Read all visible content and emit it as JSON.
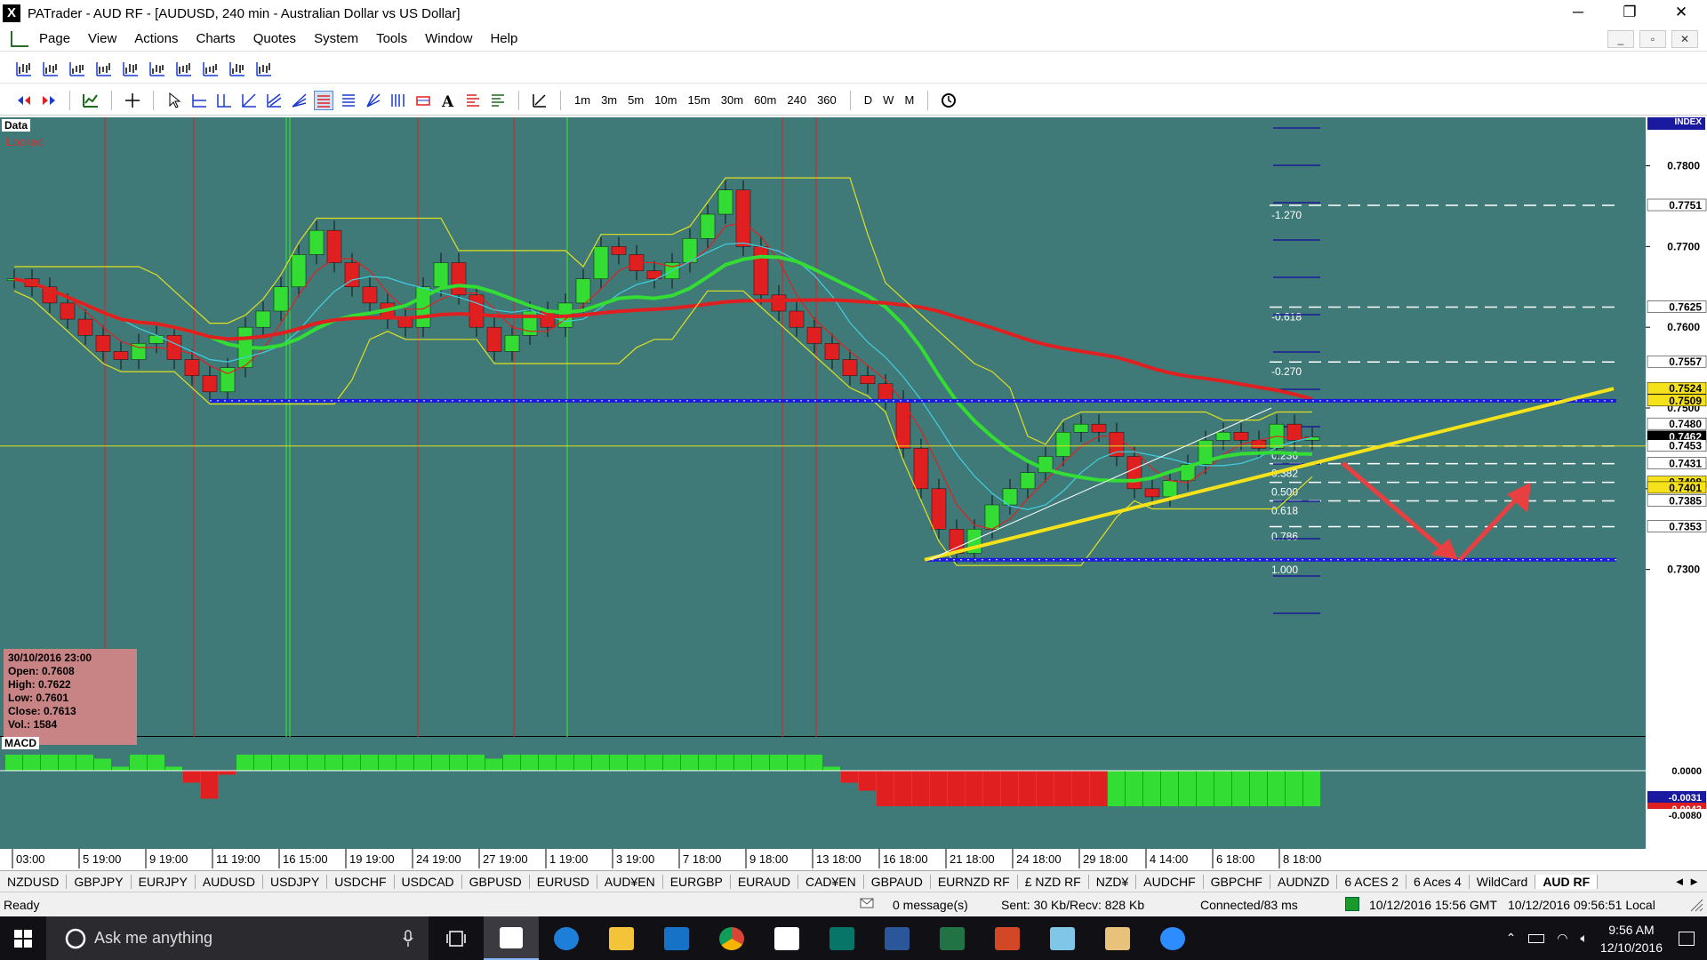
{
  "window": {
    "title": "PATrader - AUD RF - [AUDUSD, 240 min - Australian Dollar vs US Dollar]",
    "logo": "X",
    "minimize": "─",
    "restore": "❐",
    "close": "✕"
  },
  "menu": {
    "items": [
      "Page",
      "View",
      "Actions",
      "Charts",
      "Quotes",
      "System",
      "Tools",
      "Window",
      "Help"
    ],
    "mdi_min": "_",
    "mdi_restore": "▫",
    "mdi_close": "✕"
  },
  "timeframes": [
    "1m",
    "3m",
    "5m",
    "10m",
    "15m",
    "30m",
    "60m",
    "240",
    "360"
  ],
  "periods": [
    "D",
    "W",
    "M"
  ],
  "chart": {
    "data_label": "Data",
    "locked_label": "Locked",
    "index_label": "INDEX",
    "macd_label": "MACD",
    "ohlc": {
      "date": "30/10/2016 23:00",
      "open": "Open: 0.7608",
      "high": "High: 0.7622",
      "low": "Low: 0.7601",
      "close": "Close: 0.7613",
      "vol": "Vol.: 1584"
    },
    "price_ticks": [
      {
        "label": "0.7800",
        "value": 0.78
      },
      {
        "label": "0.7700",
        "value": 0.77
      },
      {
        "label": "0.7600",
        "value": 0.76
      },
      {
        "label": "0.7500",
        "value": 0.75
      },
      {
        "label": "0.7400",
        "value": 0.74
      },
      {
        "label": "0.7300",
        "value": 0.73
      }
    ],
    "price_badges": [
      {
        "label": "0.7751",
        "value": 0.7751,
        "bg": "#ffffff",
        "fg": "#000000"
      },
      {
        "label": "0.7625",
        "value": 0.7625,
        "bg": "#ffffff",
        "fg": "#000000"
      },
      {
        "label": "0.7557",
        "value": 0.7557,
        "bg": "#ffffff",
        "fg": "#000000"
      },
      {
        "label": "0.7524",
        "value": 0.7524,
        "bg": "#f5e21a",
        "fg": "#000000"
      },
      {
        "label": "0.7509",
        "value": 0.7509,
        "bg": "#f5e21a",
        "fg": "#000000"
      },
      {
        "label": "0.7480",
        "value": 0.748,
        "bg": "#ffffff",
        "fg": "#000000"
      },
      {
        "label": "0.7462",
        "value": 0.7464,
        "bg": "#000000",
        "fg": "#ffffff"
      },
      {
        "label": "0.7453",
        "value": 0.7453,
        "bg": "#ffffff",
        "fg": "#000000"
      },
      {
        "label": "0.7431",
        "value": 0.7431,
        "bg": "#ffffff",
        "fg": "#000000"
      },
      {
        "label": "0.7408",
        "value": 0.7408,
        "bg": "#f5e21a",
        "fg": "#000000"
      },
      {
        "label": "0.7401",
        "value": 0.7401,
        "bg": "#f5e21a",
        "fg": "#000000"
      },
      {
        "label": "0.7385",
        "value": 0.7385,
        "bg": "#ffffff",
        "fg": "#000000"
      },
      {
        "label": "0.7353",
        "value": 0.7353,
        "bg": "#ffffff",
        "fg": "#000000"
      }
    ],
    "fib_levels": [
      {
        "label": "-1.270",
        "value": 0.7751
      },
      {
        "label": "-0.618",
        "value": 0.7625
      },
      {
        "label": "-0.270",
        "value": 0.7557
      },
      {
        "label": "0.236",
        "value": 0.7453
      },
      {
        "label": "0.382",
        "value": 0.7431
      },
      {
        "label": "0.500",
        "value": 0.7408
      },
      {
        "label": "0.618",
        "value": 0.7385
      },
      {
        "label": "0.786",
        "value": 0.7353
      },
      {
        "label": "1.000",
        "value": 0.7312
      }
    ],
    "macd_ticks": [
      {
        "label": "0.0000",
        "bg": "#ffffff",
        "fg": "#000000"
      },
      {
        "label": "-0.0031",
        "bg": "#1a1aa0",
        "fg": "#ffffff"
      },
      {
        "label": "-0.0042",
        "bg": "#e02020",
        "fg": "#ffffff"
      },
      {
        "label": "-0.0080",
        "bg": "#ffffff",
        "fg": "#000000"
      }
    ],
    "time_labels": [
      "03:00",
      "5 19:00",
      "9 19:00",
      "11 19:00",
      "16 15:00",
      "19 19:00",
      "24 19:00",
      "27 19:00",
      "1 19:00",
      "3 19:00",
      "7 18:00",
      "9 18:00",
      "13 18:00",
      "16 18:00",
      "21 18:00",
      "24 18:00",
      "29 18:00",
      "4 14:00",
      "6 18:00",
      "8 18:00"
    ],
    "close_prices": [
      0.766,
      0.765,
      0.763,
      0.761,
      0.759,
      0.757,
      0.756,
      0.758,
      0.759,
      0.756,
      0.754,
      0.752,
      0.755,
      0.76,
      0.762,
      0.765,
      0.769,
      0.772,
      0.768,
      0.765,
      0.763,
      0.761,
      0.76,
      0.765,
      0.768,
      0.764,
      0.76,
      0.757,
      0.759,
      0.762,
      0.76,
      0.763,
      0.766,
      0.77,
      0.769,
      0.767,
      0.766,
      0.768,
      0.771,
      0.774,
      0.777,
      0.77,
      0.764,
      0.762,
      0.76,
      0.758,
      0.756,
      0.754,
      0.753,
      0.751,
      0.745,
      0.74,
      0.735,
      0.732,
      0.735,
      0.738,
      0.74,
      0.742,
      0.744,
      0.747,
      0.748,
      0.747,
      0.744,
      0.74,
      0.739,
      0.741,
      0.743,
      0.746,
      0.747,
      0.746,
      0.745,
      0.748,
      0.746,
      0.7464
    ],
    "tabs": [
      "NZDUSD",
      "GBPJPY",
      "EURJPY",
      "AUDUSD",
      "USDJPY",
      "USDCHF",
      "USDCAD",
      "GBPUSD",
      "EURUSD",
      "AUD¥EN",
      "EURGBP",
      "EURAUD",
      "CAD¥EN",
      "GBPAUD",
      "EURNZD RF",
      "£ NZD RF",
      "NZD¥",
      "AUDCHF",
      "GBPCHF",
      "AUDNZD",
      "6 ACES 2",
      "6 Aces 4",
      "WildCard",
      "AUD RF"
    ],
    "active_tab": "AUD RF",
    "tab_arrows": "◄ ►"
  },
  "status": {
    "ready": "Ready",
    "messages": "0 message(s)",
    "traffic": "Sent: 30 Kb/Recv: 828 Kb",
    "connection": "Connected/83 ms",
    "gmt_time": "10/12/2016 15:56 GMT",
    "local_time": "10/12/2016 09:56:51 Local"
  },
  "taskbar": {
    "search_placeholder": "Ask me anything",
    "clock_time": "9:56 AM",
    "clock_date": "12/10/2016",
    "apps": [
      "patrader",
      "edge",
      "explorer",
      "outlook",
      "chrome",
      "store",
      "publisher",
      "word",
      "excel",
      "powerpoint",
      "notepad",
      "tool",
      "zoom"
    ]
  },
  "colors": {
    "chart_bg": "#3f7a78",
    "bull": "#33dd33",
    "bear": "#e02020",
    "trendline": "#f5e21a",
    "support": "#1a1ae0",
    "arrow": "#e84040"
  }
}
